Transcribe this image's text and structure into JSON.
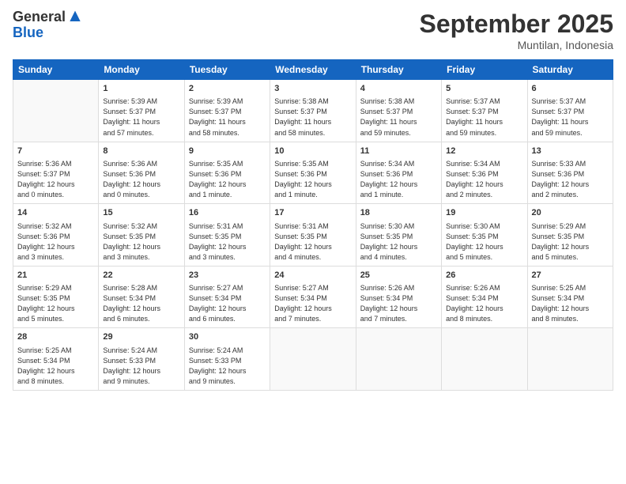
{
  "logo": {
    "general": "General",
    "blue": "Blue"
  },
  "header": {
    "month": "September 2025",
    "location": "Muntilan, Indonesia"
  },
  "weekdays": [
    "Sunday",
    "Monday",
    "Tuesday",
    "Wednesday",
    "Thursday",
    "Friday",
    "Saturday"
  ],
  "weeks": [
    [
      {
        "day": "",
        "info": ""
      },
      {
        "day": "1",
        "info": "Sunrise: 5:39 AM\nSunset: 5:37 PM\nDaylight: 11 hours\nand 57 minutes."
      },
      {
        "day": "2",
        "info": "Sunrise: 5:39 AM\nSunset: 5:37 PM\nDaylight: 11 hours\nand 58 minutes."
      },
      {
        "day": "3",
        "info": "Sunrise: 5:38 AM\nSunset: 5:37 PM\nDaylight: 11 hours\nand 58 minutes."
      },
      {
        "day": "4",
        "info": "Sunrise: 5:38 AM\nSunset: 5:37 PM\nDaylight: 11 hours\nand 59 minutes."
      },
      {
        "day": "5",
        "info": "Sunrise: 5:37 AM\nSunset: 5:37 PM\nDaylight: 11 hours\nand 59 minutes."
      },
      {
        "day": "6",
        "info": "Sunrise: 5:37 AM\nSunset: 5:37 PM\nDaylight: 11 hours\nand 59 minutes."
      }
    ],
    [
      {
        "day": "7",
        "info": "Sunrise: 5:36 AM\nSunset: 5:37 PM\nDaylight: 12 hours\nand 0 minutes."
      },
      {
        "day": "8",
        "info": "Sunrise: 5:36 AM\nSunset: 5:36 PM\nDaylight: 12 hours\nand 0 minutes."
      },
      {
        "day": "9",
        "info": "Sunrise: 5:35 AM\nSunset: 5:36 PM\nDaylight: 12 hours\nand 1 minute."
      },
      {
        "day": "10",
        "info": "Sunrise: 5:35 AM\nSunset: 5:36 PM\nDaylight: 12 hours\nand 1 minute."
      },
      {
        "day": "11",
        "info": "Sunrise: 5:34 AM\nSunset: 5:36 PM\nDaylight: 12 hours\nand 1 minute."
      },
      {
        "day": "12",
        "info": "Sunrise: 5:34 AM\nSunset: 5:36 PM\nDaylight: 12 hours\nand 2 minutes."
      },
      {
        "day": "13",
        "info": "Sunrise: 5:33 AM\nSunset: 5:36 PM\nDaylight: 12 hours\nand 2 minutes."
      }
    ],
    [
      {
        "day": "14",
        "info": "Sunrise: 5:32 AM\nSunset: 5:36 PM\nDaylight: 12 hours\nand 3 minutes."
      },
      {
        "day": "15",
        "info": "Sunrise: 5:32 AM\nSunset: 5:35 PM\nDaylight: 12 hours\nand 3 minutes."
      },
      {
        "day": "16",
        "info": "Sunrise: 5:31 AM\nSunset: 5:35 PM\nDaylight: 12 hours\nand 3 minutes."
      },
      {
        "day": "17",
        "info": "Sunrise: 5:31 AM\nSunset: 5:35 PM\nDaylight: 12 hours\nand 4 minutes."
      },
      {
        "day": "18",
        "info": "Sunrise: 5:30 AM\nSunset: 5:35 PM\nDaylight: 12 hours\nand 4 minutes."
      },
      {
        "day": "19",
        "info": "Sunrise: 5:30 AM\nSunset: 5:35 PM\nDaylight: 12 hours\nand 5 minutes."
      },
      {
        "day": "20",
        "info": "Sunrise: 5:29 AM\nSunset: 5:35 PM\nDaylight: 12 hours\nand 5 minutes."
      }
    ],
    [
      {
        "day": "21",
        "info": "Sunrise: 5:29 AM\nSunset: 5:35 PM\nDaylight: 12 hours\nand 5 minutes."
      },
      {
        "day": "22",
        "info": "Sunrise: 5:28 AM\nSunset: 5:34 PM\nDaylight: 12 hours\nand 6 minutes."
      },
      {
        "day": "23",
        "info": "Sunrise: 5:27 AM\nSunset: 5:34 PM\nDaylight: 12 hours\nand 6 minutes."
      },
      {
        "day": "24",
        "info": "Sunrise: 5:27 AM\nSunset: 5:34 PM\nDaylight: 12 hours\nand 7 minutes."
      },
      {
        "day": "25",
        "info": "Sunrise: 5:26 AM\nSunset: 5:34 PM\nDaylight: 12 hours\nand 7 minutes."
      },
      {
        "day": "26",
        "info": "Sunrise: 5:26 AM\nSunset: 5:34 PM\nDaylight: 12 hours\nand 8 minutes."
      },
      {
        "day": "27",
        "info": "Sunrise: 5:25 AM\nSunset: 5:34 PM\nDaylight: 12 hours\nand 8 minutes."
      }
    ],
    [
      {
        "day": "28",
        "info": "Sunrise: 5:25 AM\nSunset: 5:34 PM\nDaylight: 12 hours\nand 8 minutes."
      },
      {
        "day": "29",
        "info": "Sunrise: 5:24 AM\nSunset: 5:33 PM\nDaylight: 12 hours\nand 9 minutes."
      },
      {
        "day": "30",
        "info": "Sunrise: 5:24 AM\nSunset: 5:33 PM\nDaylight: 12 hours\nand 9 minutes."
      },
      {
        "day": "",
        "info": ""
      },
      {
        "day": "",
        "info": ""
      },
      {
        "day": "",
        "info": ""
      },
      {
        "day": "",
        "info": ""
      }
    ]
  ]
}
